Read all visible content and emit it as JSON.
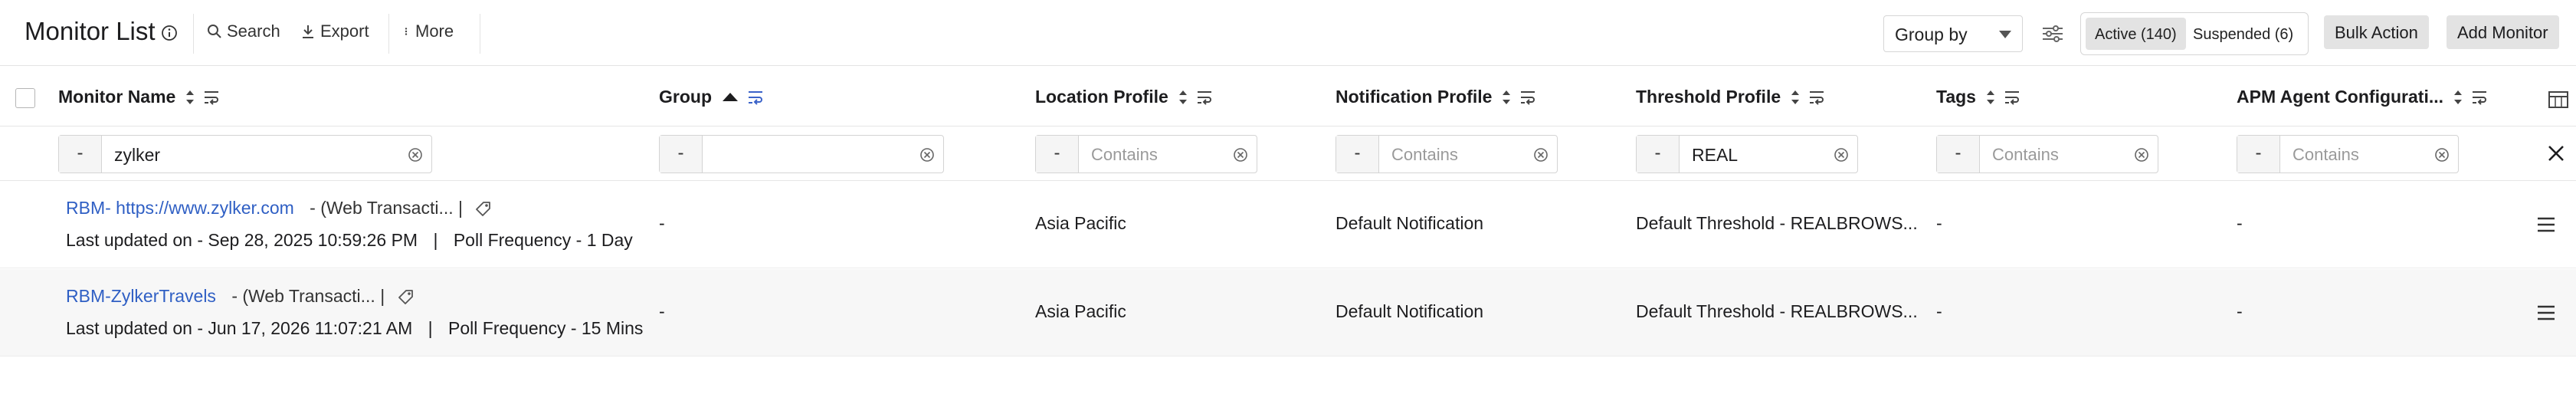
{
  "header": {
    "title": "Monitor List",
    "search_label": "Search",
    "export_label": "Export",
    "more_label": "More",
    "group_by": "Group by",
    "active_tab": "Active (140)",
    "suspended_tab": "Suspended (6)",
    "bulk_action": "Bulk Action",
    "add_monitor": "Add Monitor"
  },
  "columns": [
    {
      "label": "Monitor Name"
    },
    {
      "label": "Group"
    },
    {
      "label": "Location Profile"
    },
    {
      "label": "Notification Profile"
    },
    {
      "label": "Threshold Profile"
    },
    {
      "label": "Tags"
    },
    {
      "label": "APM Agent Configurati..."
    }
  ],
  "filters": {
    "minus": "-",
    "monitor_name": "zylker",
    "group": "",
    "location": "Contains",
    "notification": "Contains",
    "threshold": "REAL",
    "tags": "Contains",
    "apm": "Contains"
  },
  "rows": [
    {
      "name": "RBM- https://www.zylker.com",
      "type": "- (Web Transacti...",
      "updated": "Last updated on - Sep 28, 2025 10:59:26 PM",
      "freq": "Poll Frequency - 1 Day",
      "group": "-",
      "location": "Asia Pacific",
      "notification": "Default Notification",
      "threshold": "Default Threshold - REALBROWS...",
      "tags": "-",
      "apm": "-"
    },
    {
      "name": "RBM-ZylkerTravels",
      "type": "- (Web Transacti...",
      "updated": "Last updated on - Jun 17, 2026 11:07:21 AM",
      "freq": "Poll Frequency - 15 Mins",
      "group": "-",
      "location": "Asia Pacific",
      "notification": "Default Notification",
      "threshold": "Default Threshold - REALBROWS...",
      "tags": "-",
      "apm": "-"
    }
  ],
  "separator": "|"
}
